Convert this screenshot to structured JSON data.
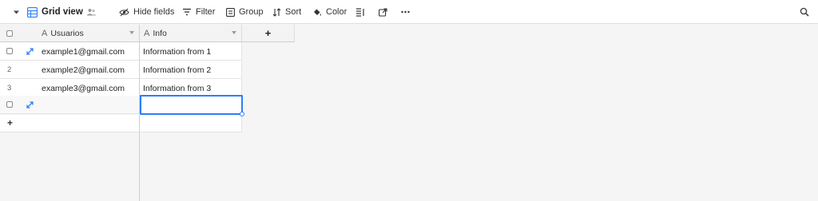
{
  "toolbar": {
    "view_name": "Grid view",
    "hide_fields_label": "Hide fields",
    "filter_label": "Filter",
    "group_label": "Group",
    "sort_label": "Sort",
    "color_label": "Color"
  },
  "columns": {
    "primary": {
      "label": "Usuarios",
      "type_icon": "A"
    },
    "secondary": {
      "label": "Info",
      "type_icon": "A"
    },
    "add_label": "+"
  },
  "rows": [
    {
      "number": "1",
      "email": "example1@gmail.com",
      "info": "Information from 1"
    },
    {
      "number": "2",
      "email": "example2@gmail.com",
      "info": "Information from 2"
    },
    {
      "number": "3",
      "email": "example3@gmail.com",
      "info": "Information from 3"
    }
  ],
  "add_row_label": "+",
  "colors": {
    "accent": "#2d7ff9",
    "grid_icon": "#2d7ff9"
  },
  "icons": [
    "chevron-down-icon",
    "grid-icon",
    "people-icon",
    "hide-fields-icon",
    "filter-icon",
    "group-icon",
    "sort-icon",
    "paint-bucket-icon",
    "row-height-icon",
    "share-icon",
    "more-icon",
    "search-icon",
    "expand-icon",
    "checkbox"
  ]
}
